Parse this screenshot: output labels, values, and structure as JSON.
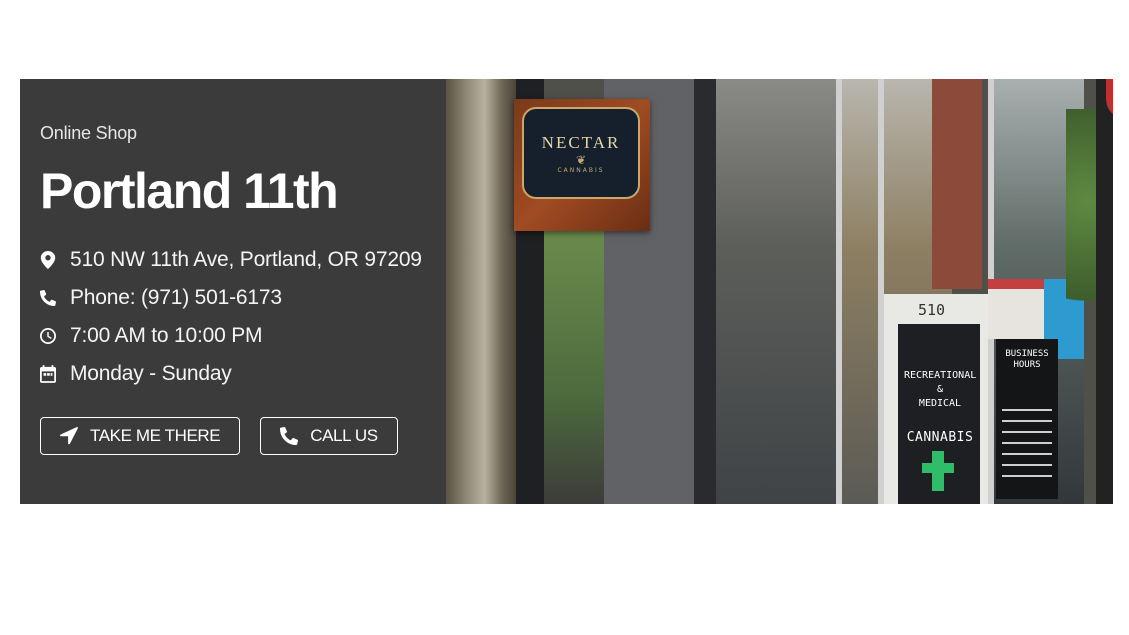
{
  "location": {
    "eyebrow": "Online Shop",
    "title": "Portland 11th",
    "address": "510 NW 11th Ave, Portland, OR 97209",
    "phone": "Phone: (971) 501-6173",
    "hours": "7:00 AM to 10:00 PM",
    "days": "Monday - Sunday"
  },
  "buttons": {
    "directions": "TAKE ME THERE",
    "call": "CALL US"
  },
  "photo": {
    "sign_name": "NECTAR",
    "sign_sub": "CANNABIS",
    "door_number": "510",
    "door_line1": "RECREATIONAL",
    "door_line2": "&",
    "door_line3": "MEDICAL",
    "door_line4": "CANNABIS",
    "menu_title_line1": "BUSINESS",
    "menu_title_line2": "HOURS"
  },
  "icons": {
    "address": "map-marker-icon",
    "phone": "phone-icon",
    "hours": "clock-icon",
    "days": "calendar-icon",
    "directions": "location-arrow-icon",
    "call": "phone-icon"
  },
  "colors": {
    "panel_bg": "#3b3b3b",
    "text": "#ffffff"
  }
}
